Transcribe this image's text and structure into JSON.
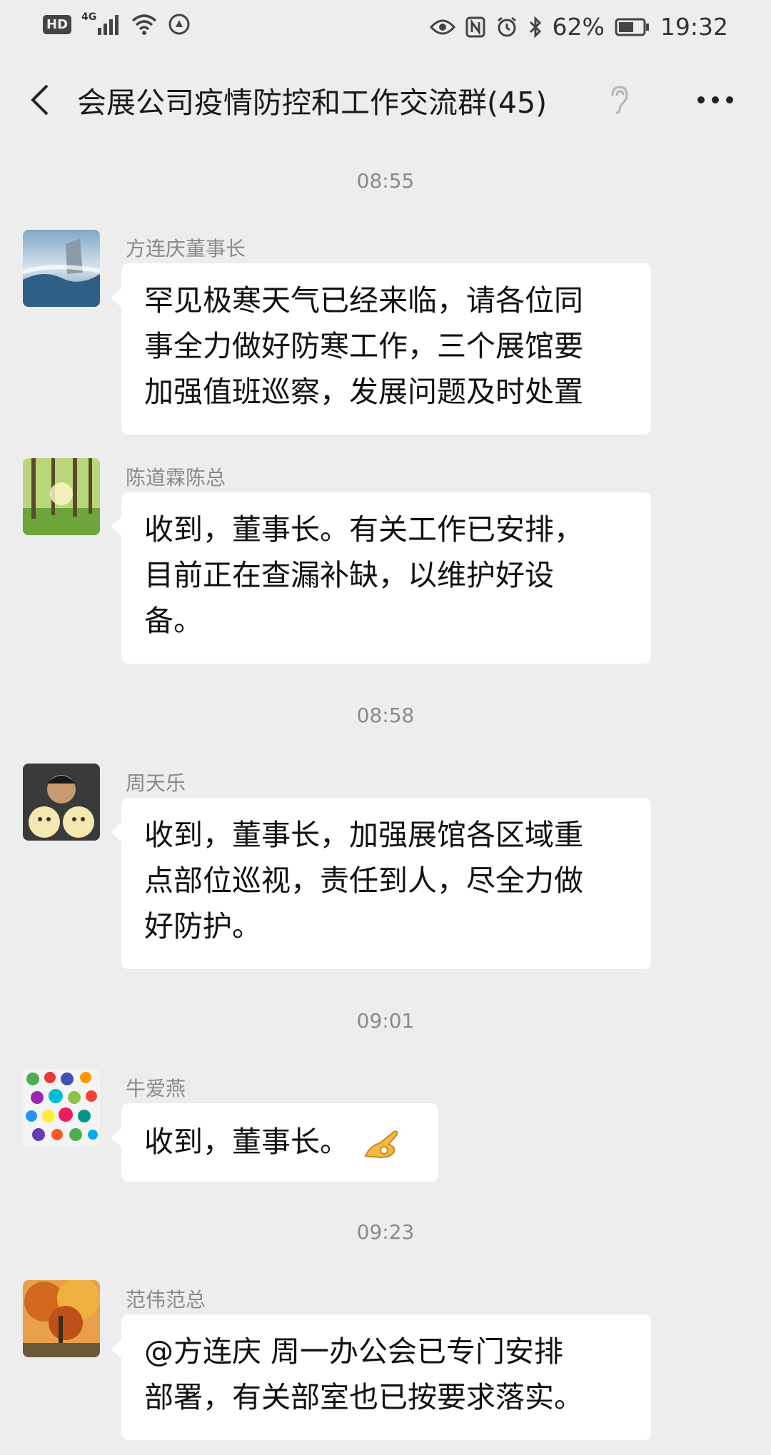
{
  "status_bar": {
    "hd": "HD",
    "network": "4G",
    "battery": "62%",
    "time": "19:32"
  },
  "header": {
    "title": "会展公司疫情防控和工作交流群(45)"
  },
  "messages": [
    {
      "time": "08:55"
    },
    {
      "sender": "方连庆董事长",
      "lines": [
        "罕见极寒天气已经来临，请各位同",
        "事全力做好防寒工作，三个展馆要",
        "加强值班巡察，发展问题及时处置"
      ]
    },
    {
      "sender": "陈道霖陈总",
      "lines": [
        "收到，董事长。有关工作已安排，",
        "目前正在查漏补缺，以维护好设",
        "备。"
      ]
    },
    {
      "time": "08:58"
    },
    {
      "sender": "周天乐",
      "lines": [
        "收到，董事长，加强展馆各区域重",
        "点部位巡视，责任到人，尽全力做",
        "好防护。"
      ]
    },
    {
      "time": "09:01"
    },
    {
      "sender": "牛爱燕",
      "lines": [
        "收到，董事长。"
      ]
    },
    {
      "time": "09:23"
    },
    {
      "sender": "范伟范总",
      "lines": [
        "@方连庆  周一办公会已专门安排",
        "部署，有关部室也已按要求落实。"
      ]
    }
  ]
}
